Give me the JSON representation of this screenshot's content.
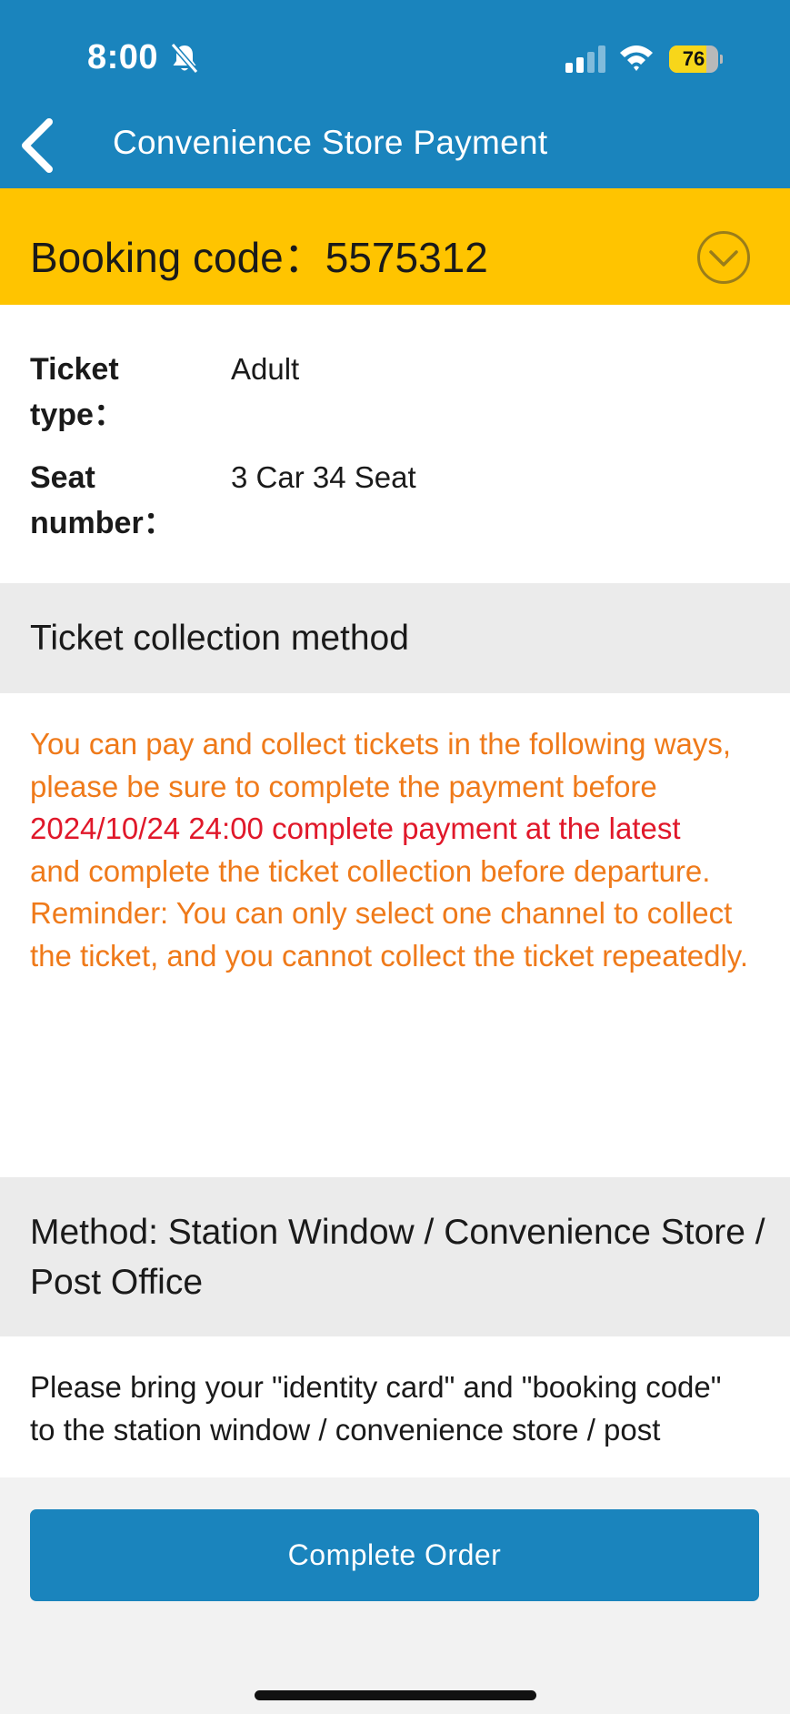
{
  "status_bar": {
    "time": "8:00",
    "battery_level": "76",
    "battery_fraction": 0.76,
    "icons": [
      "bell-slash-icon",
      "cellular-signal-icon",
      "wifi-icon",
      "battery-icon"
    ]
  },
  "nav": {
    "title": "Convenience Store Payment",
    "back_icon": "chevron-left-icon"
  },
  "booking": {
    "label": "Booking code：5575312",
    "toggle_icon": "chevron-down-circle-icon"
  },
  "ticket_info": [
    {
      "label": "Ticket type：",
      "value": "Adult"
    },
    {
      "label": "Seat number：",
      "value": "3 Car 34 Seat"
    }
  ],
  "collection": {
    "header": "Ticket collection method",
    "notice": {
      "line1": "You can pay and collect tickets in the following ways,",
      "line2": "please be sure to complete the payment before",
      "line3": "2024/10/24 24:00 complete payment at the latest",
      "line4": "and complete the ticket collection before departure.",
      "line5": "Reminder: You can only select one channel to collect the ticket, and you cannot collect the ticket repeatedly."
    }
  },
  "method": {
    "header": "Method: Station Window / Convenience Store / Post Office",
    "instructions_line1": "Please bring your \"identity card\" and \"booking code\"",
    "instructions_line2": "to the station window / convenience store / post"
  },
  "footer": {
    "complete_button": "Complete Order"
  },
  "colors": {
    "primary_blue": "#1a84bd",
    "booking_yellow": "#ffc400",
    "notice_orange": "#ef7a1a",
    "deadline_red": "#e0182a",
    "section_gray": "#ebebeb"
  }
}
